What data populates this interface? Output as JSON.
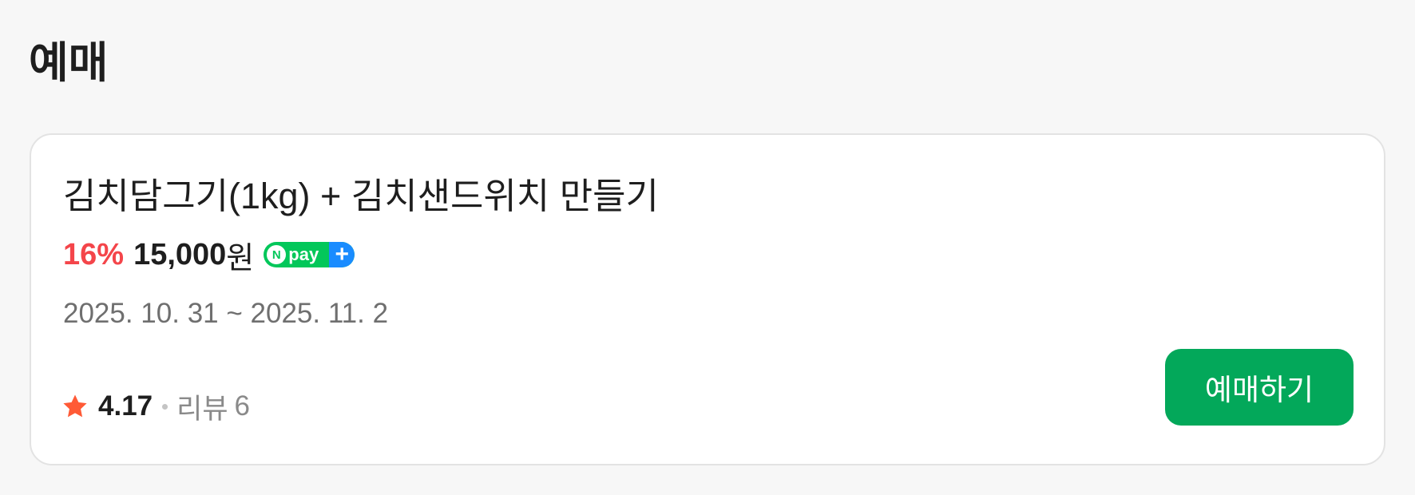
{
  "section": {
    "title": "예매"
  },
  "product": {
    "title": "김치담그기(1kg) + 김치샌드위치 만들기",
    "discount": "16%",
    "price": "15,000",
    "price_unit": "원",
    "npay_badge": {
      "n_letter": "N",
      "text": "pay",
      "plus": "+",
      "icon": "npay-plus-badge-icon"
    },
    "period": "2025. 10. 31 ~ 2025. 11. 2",
    "rating": {
      "icon": "star-icon",
      "value": "4.17",
      "review_label": "리뷰",
      "review_count": "6"
    },
    "reserve_button": "예매하기"
  },
  "colors": {
    "background": "#f7f7f7",
    "card": "#ffffff",
    "discount": "#f4454a",
    "star": "#ff5a36",
    "button": "#03a85a",
    "npay_green": "#03c75a",
    "npay_blue": "#1a8cff"
  }
}
